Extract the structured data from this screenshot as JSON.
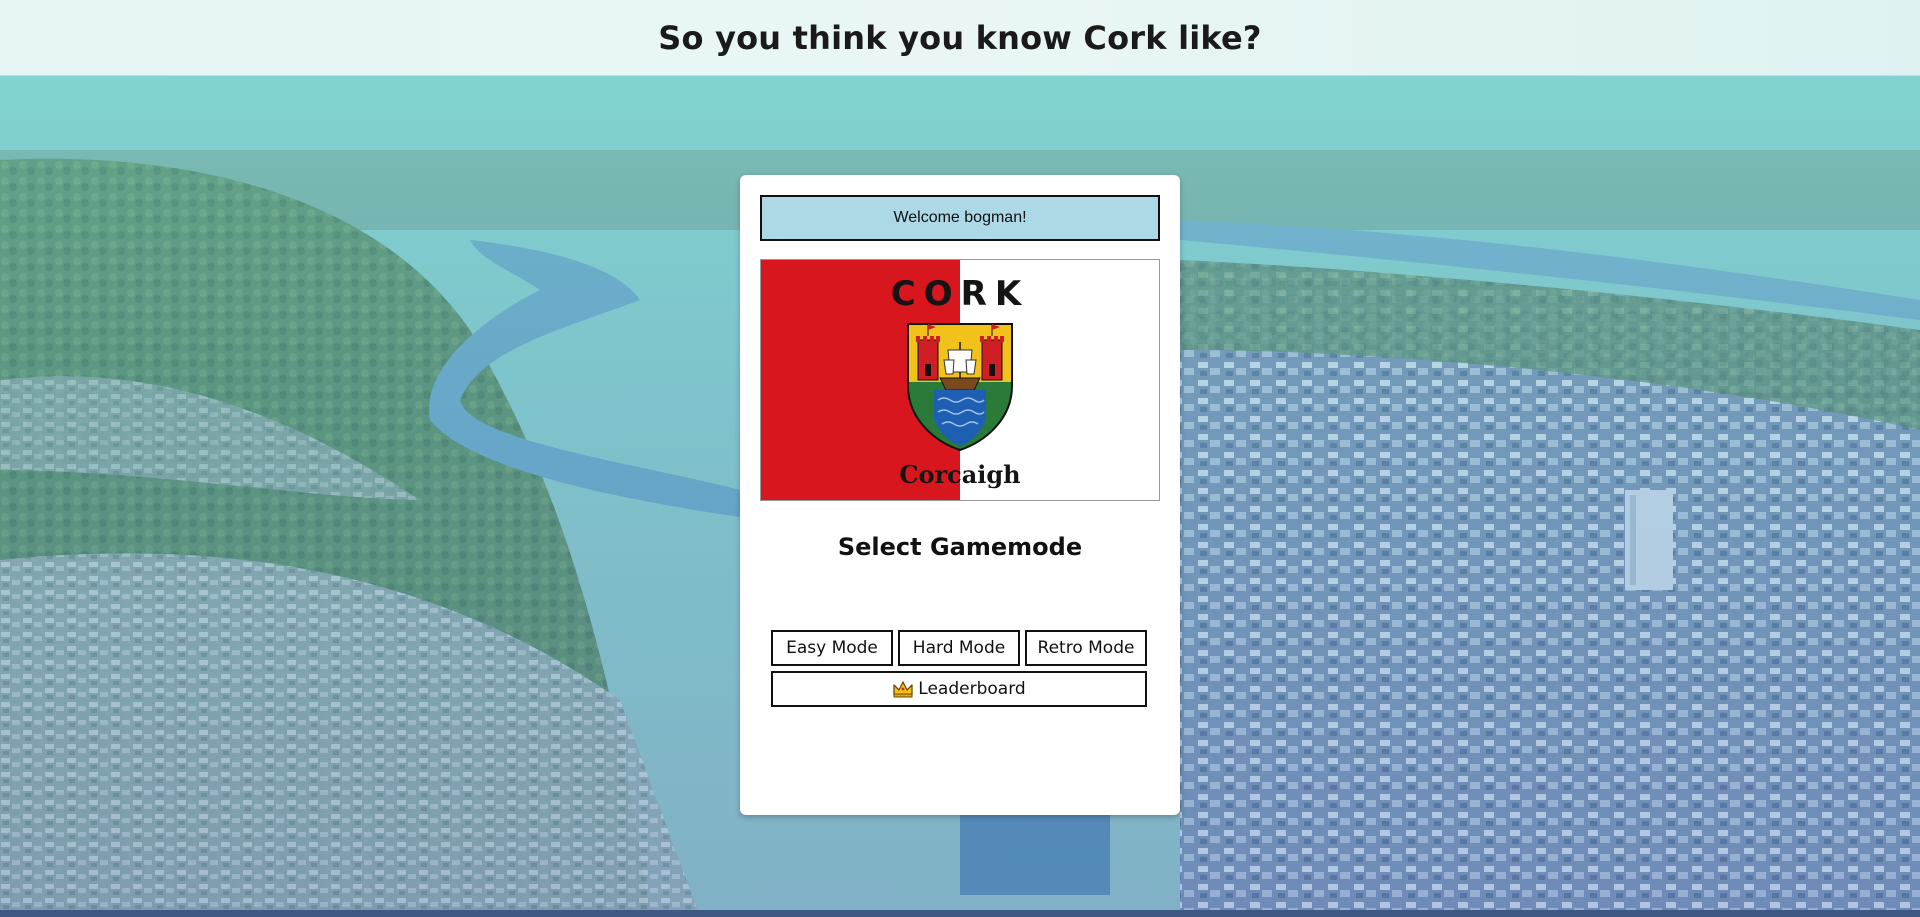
{
  "header": {
    "title": "So you think you know Cork like?"
  },
  "card": {
    "welcome_text": "Welcome bogman!",
    "flag": {
      "top_text": "CORK",
      "bottom_text": "Corcaigh",
      "colors": {
        "left": "#d8161e",
        "right": "#ffffff"
      }
    },
    "select_title": "Select Gamemode",
    "modes": [
      {
        "label": "Easy Mode"
      },
      {
        "label": "Hard Mode"
      },
      {
        "label": "Retro Mode"
      }
    ],
    "leaderboard": {
      "label": "Leaderboard",
      "icon": "crown-icon"
    }
  },
  "colors": {
    "welcome_bg": "#add8e6",
    "header_bg": "#e6f5f4",
    "card_bg": "#ffffff"
  }
}
